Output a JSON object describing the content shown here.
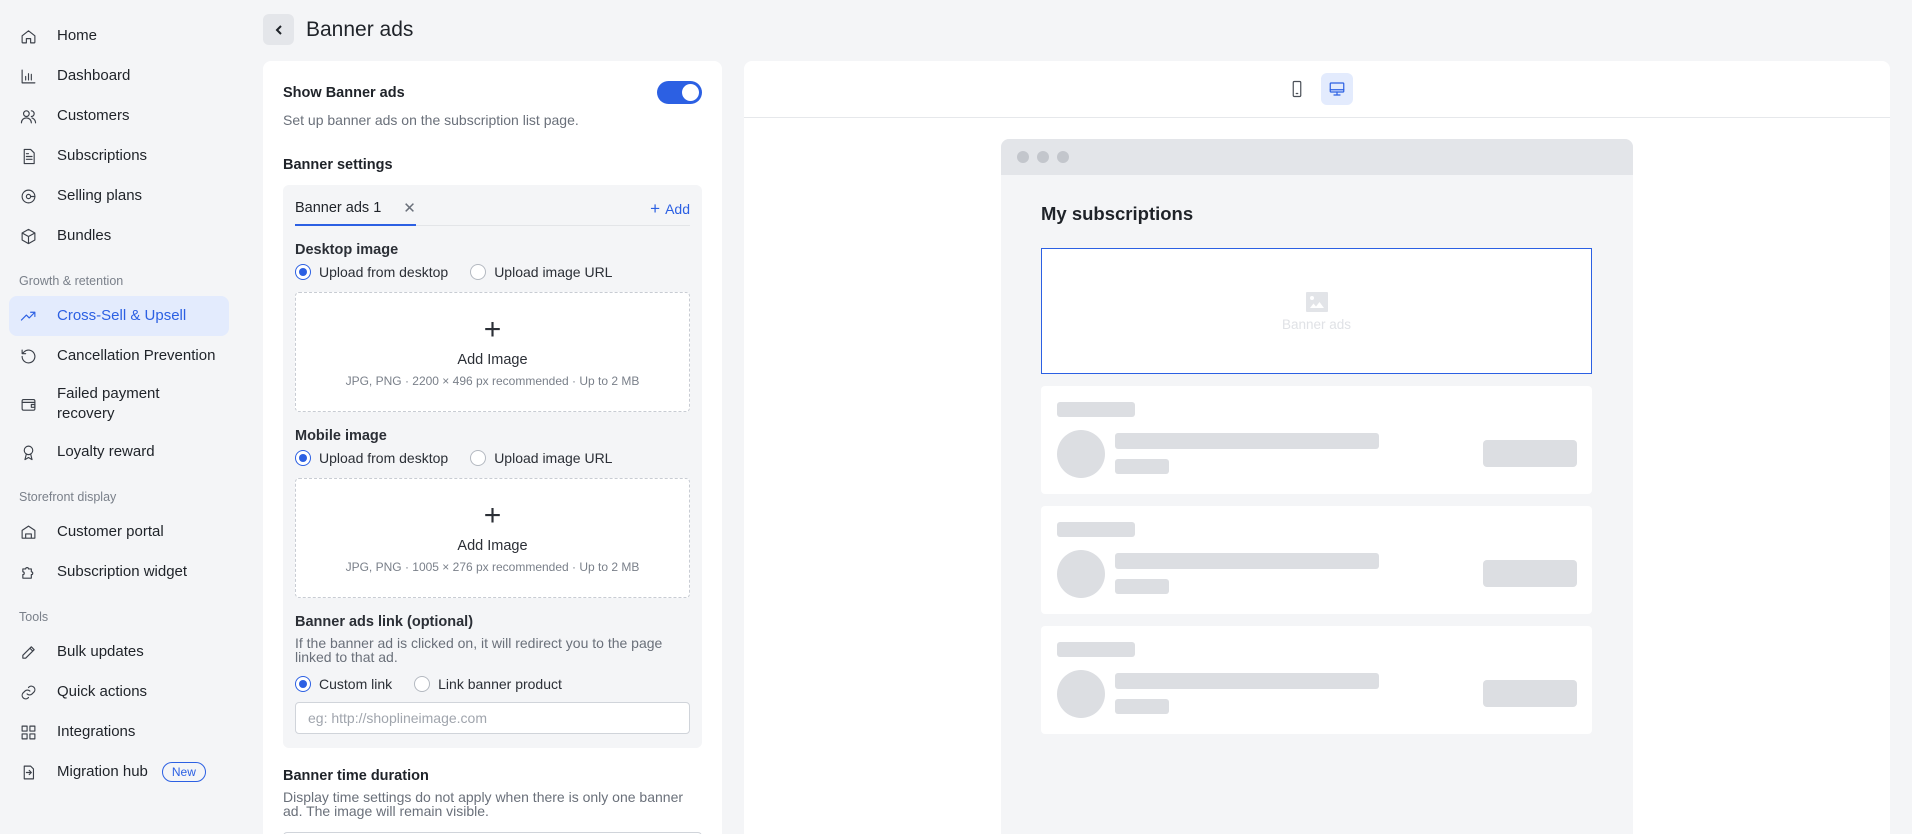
{
  "sidebar": {
    "main": [
      {
        "label": "Home",
        "icon": "home-icon"
      },
      {
        "label": "Dashboard",
        "icon": "chart-icon"
      },
      {
        "label": "Customers",
        "icon": "users-icon"
      },
      {
        "label": "Subscriptions",
        "icon": "document-icon"
      },
      {
        "label": "Selling plans",
        "icon": "tag-icon"
      },
      {
        "label": "Bundles",
        "icon": "box-icon"
      }
    ],
    "growth_title": "Growth & retention",
    "growth": [
      {
        "label": "Cross-Sell & Upsell",
        "icon": "trend-up-icon",
        "active": true
      },
      {
        "label": "Cancellation Prevention",
        "icon": "refresh-icon"
      },
      {
        "label": "Failed payment recovery",
        "icon": "wallet-icon"
      },
      {
        "label": "Loyalty reward",
        "icon": "medal-icon"
      }
    ],
    "storefront_title": "Storefront display",
    "storefront": [
      {
        "label": "Customer portal",
        "icon": "portal-icon"
      },
      {
        "label": "Subscription widget",
        "icon": "puzzle-icon"
      }
    ],
    "tools_title": "Tools",
    "tools": [
      {
        "label": "Bulk updates",
        "icon": "edit-icon"
      },
      {
        "label": "Quick actions",
        "icon": "link-icon"
      },
      {
        "label": "Integrations",
        "icon": "grid-icon"
      },
      {
        "label": "Migration hub",
        "icon": "migrate-icon",
        "badge": "New"
      }
    ]
  },
  "header": {
    "title": "Banner ads"
  },
  "settings": {
    "show_label": "Show Banner ads",
    "show_helper": "Set up banner ads on the subscription list page.",
    "show_enabled": true,
    "banner_settings_title": "Banner settings",
    "tab_label": "Banner ads 1",
    "add_label": "Add",
    "desktop": {
      "label": "Desktop image",
      "opt_upload": "Upload from desktop",
      "opt_url": "Upload image URL",
      "add_image": "Add Image",
      "hint": "JPG, PNG · 2200 × 496 px recommended · Up to 2 MB"
    },
    "mobile": {
      "label": "Mobile image",
      "opt_upload": "Upload from desktop",
      "opt_url": "Upload image URL",
      "add_image": "Add Image",
      "hint": "JPG, PNG · 1005 × 276 px recommended · Up to 2 MB"
    },
    "link": {
      "label": "Banner ads link (optional)",
      "helper": "If the banner ad is clicked on, it will redirect you to the page linked to that ad.",
      "opt_custom": "Custom link",
      "opt_product": "Link banner product",
      "placeholder": "eg: http://shoplineimage.com",
      "value": ""
    },
    "duration": {
      "label": "Banner time duration",
      "helper": "Display time settings do not apply when there is only one banner ad. The image will remain visible."
    }
  },
  "preview": {
    "store_title": "My subscriptions",
    "banner_placeholder": "Banner ads",
    "active_device": "desktop"
  },
  "colors": {
    "accent": "#2c60e3",
    "active_bg": "#e3ebfd"
  }
}
